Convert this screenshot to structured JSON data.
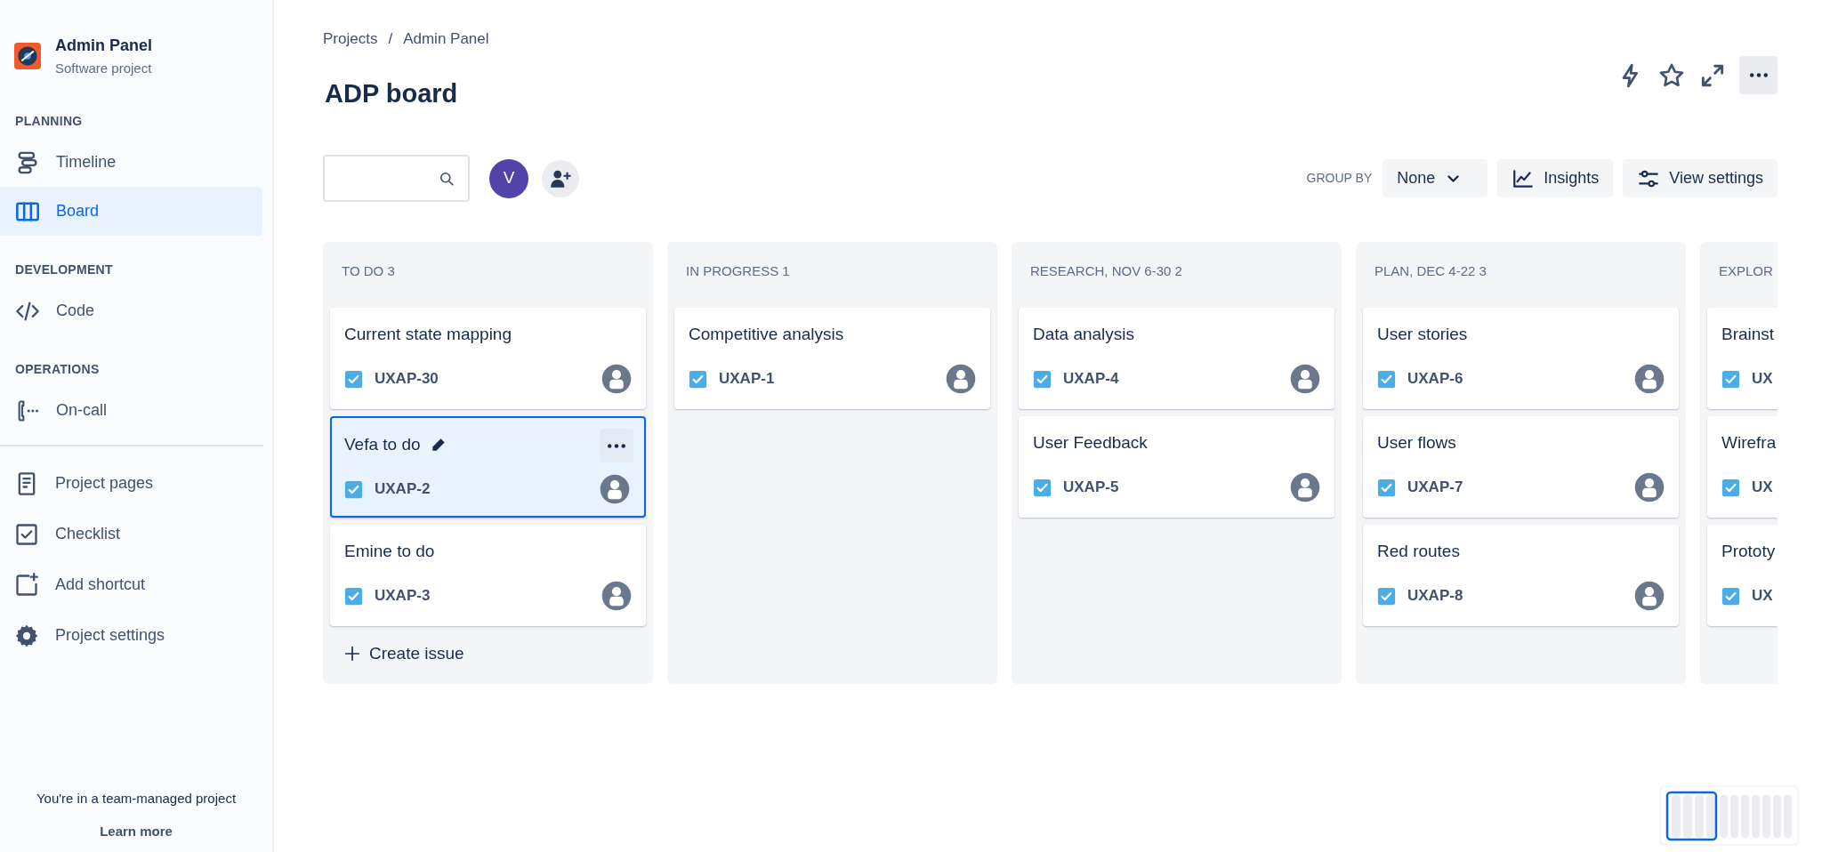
{
  "sidebar": {
    "project": {
      "name": "Admin Panel",
      "type": "Software project"
    },
    "sections": [
      {
        "heading": "PLANNING",
        "items": [
          {
            "label": "Timeline",
            "selected": false
          },
          {
            "label": "Board",
            "selected": true
          }
        ]
      },
      {
        "heading": "DEVELOPMENT",
        "items": [
          {
            "label": "Code",
            "selected": false
          }
        ]
      },
      {
        "heading": "OPERATIONS",
        "items": [
          {
            "label": "On-call",
            "selected": false
          }
        ]
      }
    ],
    "links": [
      "Project pages",
      "Checklist",
      "Add shortcut",
      "Project settings"
    ],
    "footer": {
      "text": "You're in a team-managed project",
      "link": "Learn more"
    }
  },
  "breadcrumbs": {
    "items": [
      "Projects",
      "Admin Panel"
    ],
    "separator": "/"
  },
  "title": "ADP board",
  "toolbar": {
    "avatar": "V",
    "group_by": {
      "label": "GROUP BY",
      "value": "None"
    },
    "buttons": [
      "Insights",
      "View settings"
    ]
  },
  "columns": [
    {
      "title": "TO DO 3",
      "cards": [
        {
          "title": "Current state mapping",
          "key": "UXAP-30",
          "avatar": true,
          "selected": false
        },
        {
          "title": "Vefa to do",
          "key": "UXAP-2",
          "avatar": true,
          "selected": true
        },
        {
          "title": "Emine to do",
          "key": "UXAP-3",
          "avatar": true,
          "selected": false
        }
      ],
      "create": "Create issue"
    },
    {
      "title": "IN PROGRESS 1",
      "cards": [
        {
          "title": "Competitive analysis",
          "key": "UXAP-1",
          "avatar": true,
          "selected": false
        }
      ]
    },
    {
      "title": "RESEARCH, NOV 6-30 2",
      "cards": [
        {
          "title": "Data analysis",
          "key": "UXAP-4",
          "avatar": true,
          "selected": false
        },
        {
          "title": "User Feedback",
          "key": "UXAP-5",
          "avatar": true,
          "selected": false
        }
      ]
    },
    {
      "title": "PLAN, DEC 4-22 3",
      "cards": [
        {
          "title": "User stories",
          "key": "UXAP-6",
          "avatar": true,
          "selected": false
        },
        {
          "title": "User flows",
          "key": "UXAP-7",
          "avatar": true,
          "selected": false
        },
        {
          "title": "Red routes",
          "key": "UXAP-8",
          "avatar": true,
          "selected": false
        }
      ]
    },
    {
      "title": "EXPLOR",
      "cards": [
        {
          "title": "Brainst",
          "key": "UX",
          "avatar": false,
          "selected": false
        },
        {
          "title": "Wirefra",
          "key": "UX",
          "avatar": false,
          "selected": false
        },
        {
          "title": "Prototy",
          "key": "UX",
          "avatar": false,
          "selected": false
        }
      ]
    }
  ]
}
